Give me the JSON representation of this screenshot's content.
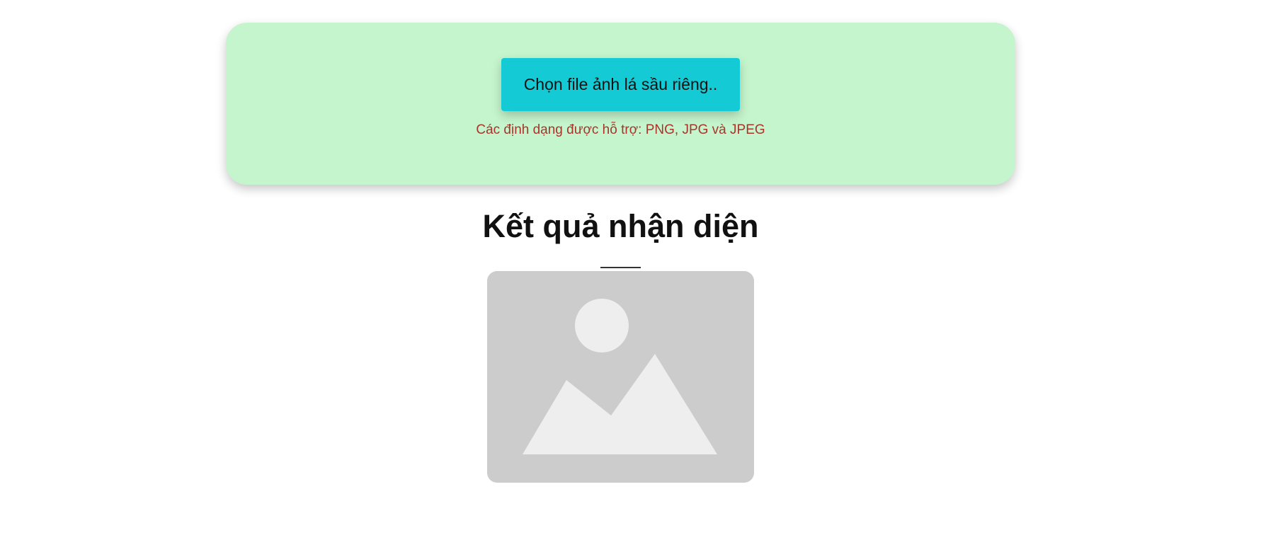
{
  "upload": {
    "button_label": "Chọn file ảnh lá sầu riêng..",
    "formats_note": "Các định dạng được hỗ trợ: PNG, JPG và JPEG"
  },
  "result": {
    "title": "Kết quả nhận diện",
    "image_placeholder_icon": "image-placeholder-icon"
  },
  "colors": {
    "panel_background": "#c5f5cc",
    "button_background": "#14cad4",
    "note_text": "#a9342b",
    "placeholder_background": "#cccccc",
    "placeholder_shapes": "#eeeeee"
  }
}
